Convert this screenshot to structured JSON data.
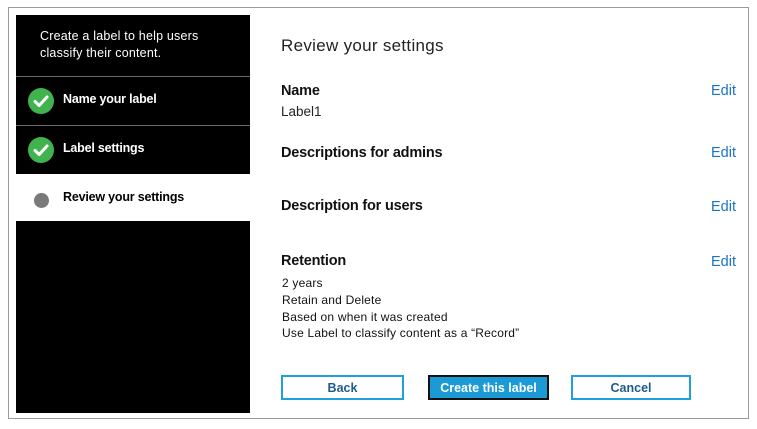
{
  "sidebar": {
    "intro": "Create a label to help users classify their content.",
    "steps": [
      {
        "label": "Name your label",
        "status": "complete"
      },
      {
        "label": "Label settings",
        "status": "complete"
      },
      {
        "label": "Review your settings",
        "status": "current"
      }
    ]
  },
  "main": {
    "title": "Review your settings",
    "edit_label": "Edit",
    "sections": {
      "name": {
        "title": "Name",
        "value": "Label1"
      },
      "admin_desc": {
        "title": "Descriptions for admins"
      },
      "user_desc": {
        "title": "Description for users"
      },
      "retention": {
        "title": "Retention",
        "lines": [
          "2 years",
          "Retain and Delete",
          "Based on when it was created",
          "Use Label to classify content as a “Record”"
        ]
      }
    }
  },
  "buttons": {
    "back": "Back",
    "create": "Create this label",
    "cancel": "Cancel"
  },
  "colors": {
    "accent": "#1c9ad6",
    "check": "#40b34f",
    "link": "#1a73c8"
  }
}
